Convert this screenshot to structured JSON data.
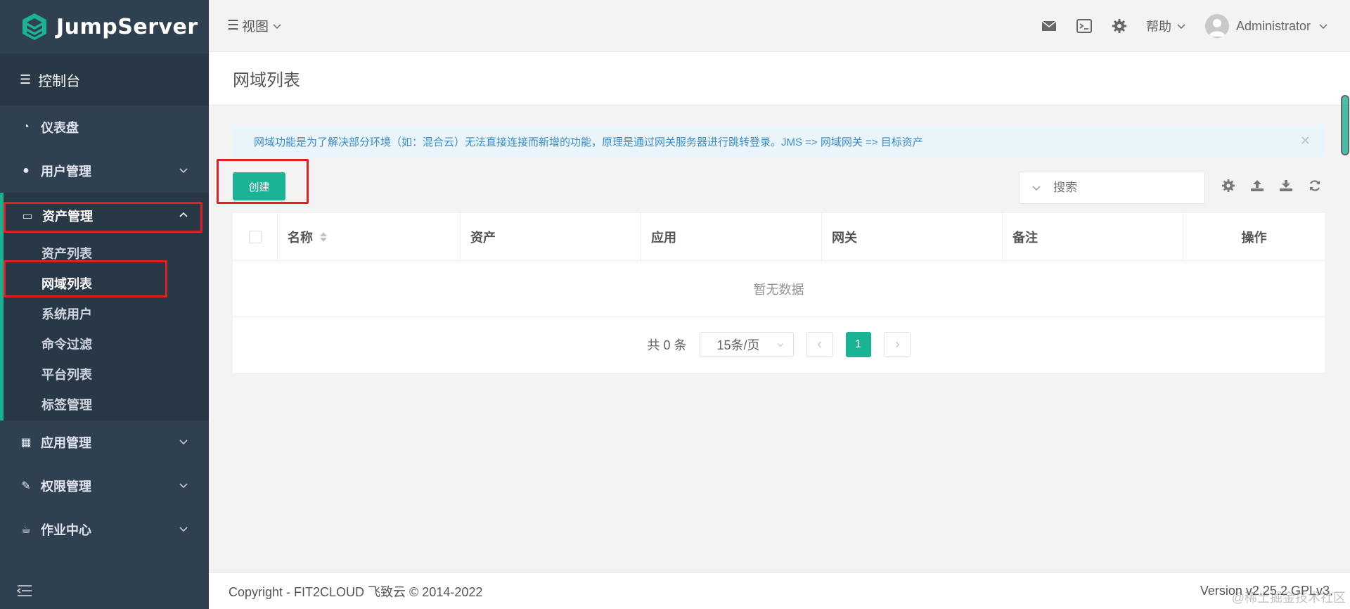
{
  "brand": {
    "name": "JumpServer"
  },
  "sidebar": {
    "console_label": "控制台",
    "items": [
      {
        "label": "仪表盘",
        "icon": "dashboard-icon"
      },
      {
        "label": "用户管理",
        "icon": "users-icon"
      },
      {
        "label": "资产管理",
        "icon": "hdd-icon"
      },
      {
        "label": "应用管理",
        "icon": "grid-icon"
      },
      {
        "label": "权限管理",
        "icon": "edit-icon"
      },
      {
        "label": "作业中心",
        "icon": "coffee-icon"
      }
    ],
    "asset_subitems": [
      "资产列表",
      "网域列表",
      "系统用户",
      "命令过滤",
      "平台列表",
      "标签管理"
    ],
    "active_subitem": "网域列表"
  },
  "topbar": {
    "view_label": "视图",
    "help_label": "帮助",
    "user_name": "Administrator"
  },
  "page": {
    "title": "网域列表",
    "alert_text": "网域功能是为了解决部分环境（如：混合云）无法直接连接而新增的功能，原理是通过网关服务器进行跳转登录。JMS => 网域网关 => 目标资产",
    "create_label": "创建",
    "search_placeholder": "搜索"
  },
  "table": {
    "columns": [
      "名称",
      "资产",
      "应用",
      "网关",
      "备注",
      "操作"
    ],
    "empty_text": "暂无数据"
  },
  "pagination": {
    "total_text": "共 0 条",
    "page_size": "15条/页",
    "current_page": "1"
  },
  "footer": {
    "copyright": "Copyright - FIT2CLOUD 飞致云 © 2014-2022",
    "version": "Version v2.25.2 GPLv3."
  },
  "watermark": "@稀土掘金技术社区",
  "colors": {
    "accent": "#1ab394",
    "sidebar": "#2f4050",
    "highlight_box": "#e02020"
  }
}
